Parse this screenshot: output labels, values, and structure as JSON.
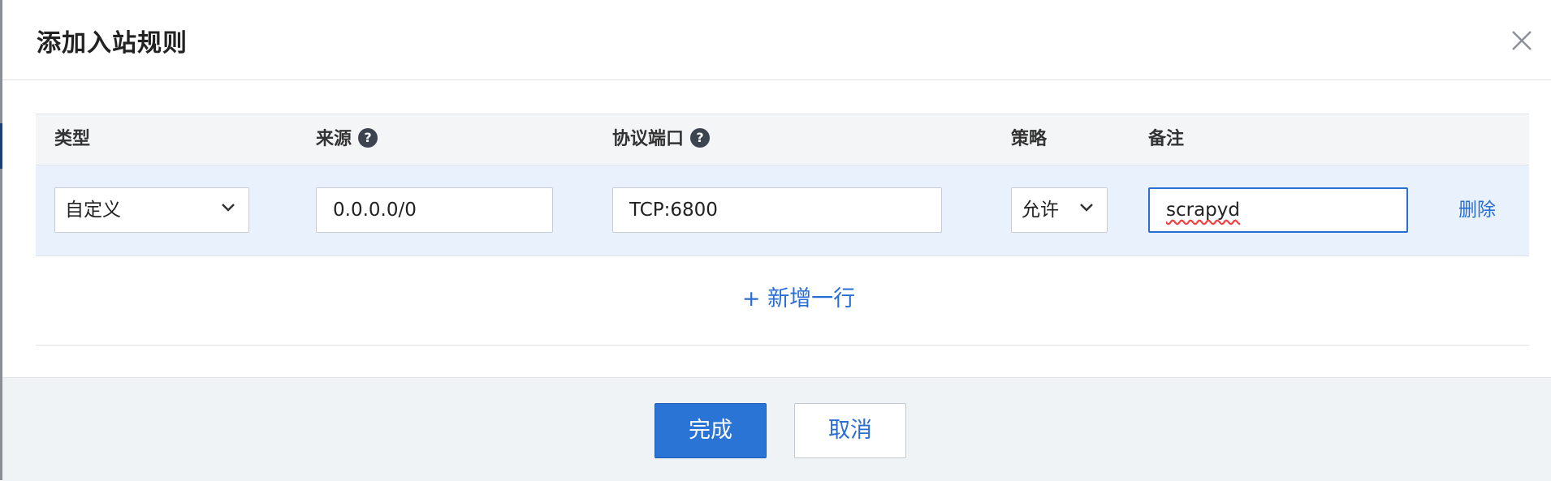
{
  "dialog": {
    "title": "添加入站规则"
  },
  "table": {
    "headers": {
      "type": "类型",
      "source": "来源",
      "protocol_port": "协议端口",
      "policy": "策略",
      "note": "备注"
    },
    "rows": [
      {
        "type": "自定义",
        "source": "0.0.0.0/0",
        "protocol_port": "TCP:6800",
        "policy": "允许",
        "note": "scrapyd",
        "delete_label": "删除"
      }
    ]
  },
  "add_row_label": "+ 新增一行",
  "footer": {
    "confirm_label": "完成",
    "cancel_label": "取消"
  },
  "colors": {
    "accent": "#2a74d6",
    "row_highlight": "#e9f1fc",
    "footer_bg": "#eff3f6"
  }
}
